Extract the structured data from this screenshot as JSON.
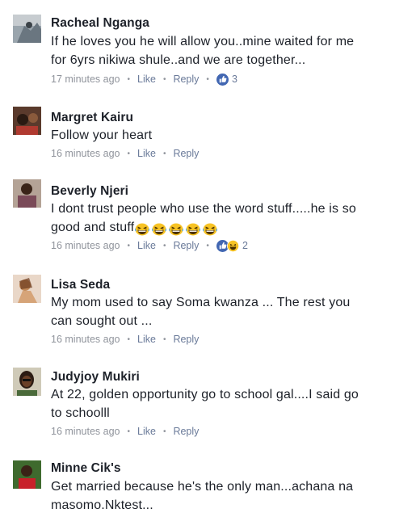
{
  "comments": [
    {
      "author": "Racheal Nganga",
      "text_lines": [
        "If he loves you he will allow you..mine waited for me",
        "for 6yrs nikiwa shule..and we are together..."
      ],
      "time": "17 minutes ago",
      "like_label": "Like",
      "reply_label": "Reply",
      "reactions": {
        "icons": [
          "like-icon"
        ],
        "count": "3"
      }
    },
    {
      "author": "Margret Kairu",
      "text_lines": [
        "Follow your heart"
      ],
      "time": "16 minutes ago",
      "like_label": "Like",
      "reply_label": "Reply"
    },
    {
      "author": "Beverly Njeri",
      "text_lines": [
        "I dont trust people who use the word stuff.....he is so",
        "good and stuff"
      ],
      "emoji": [
        "laughing-emoji",
        "laughing-emoji",
        "laughing-emoji",
        "laughing-emoji",
        "laughing-emoji"
      ],
      "time": "16 minutes ago",
      "like_label": "Like",
      "reply_label": "Reply",
      "reactions": {
        "icons": [
          "like-icon",
          "haha-icon"
        ],
        "count": "2"
      }
    },
    {
      "author": "Lisa Seda",
      "text_lines": [
        "My mom used to say Soma kwanza ... The rest you",
        "can sought out ..."
      ],
      "time": "16 minutes ago",
      "like_label": "Like",
      "reply_label": "Reply"
    },
    {
      "author": "Judyjoy Mukiri",
      "text_lines": [
        "At 22, golden opportunity go to school gal....I said go",
        "to schoolll"
      ],
      "time": "16 minutes ago",
      "like_label": "Like",
      "reply_label": "Reply"
    },
    {
      "author": "Minne Cik's",
      "text_lines": [
        "Get married because he's the only man...achana na",
        "masomo.Nktest..."
      ]
    }
  ],
  "colors": {
    "name": "#1d2129",
    "meta": "#90949c",
    "link": "#6a7a99",
    "like_blue": "#4267b2",
    "emoji_yellow": "#f7c325"
  }
}
